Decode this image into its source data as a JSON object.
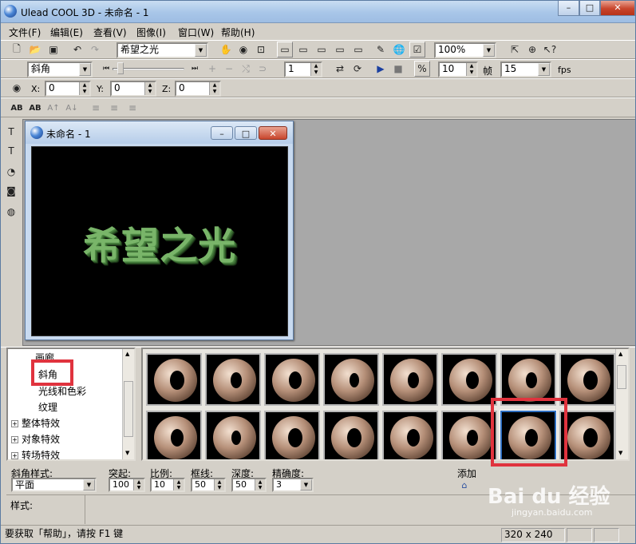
{
  "window": {
    "title": "Ulead COOL 3D - 未命名 - 1",
    "minimize": "–",
    "maximize": "□",
    "close": "✕"
  },
  "menubar": [
    "文件(F)",
    "编辑(E)",
    "查看(V)",
    "图像(I)",
    "窗口(W)",
    "帮助(H)"
  ],
  "toolbar1": {
    "text_combo": "希望之光",
    "zoom_combo": "100%"
  },
  "toolbar2": {
    "bevel_combo": "斜角",
    "frame_value": "1",
    "fps_count": "10",
    "frame_label": "帧",
    "fps_value": "15",
    "fps_label": "fps"
  },
  "toolbar3": {
    "x_label": "X:",
    "x_value": "0",
    "y_label": "Y:",
    "y_value": "0",
    "z_label": "Z:",
    "z_value": "0"
  },
  "toolbar4": {
    "icons": [
      "AB",
      "AB",
      "A↑",
      "A↓"
    ]
  },
  "document": {
    "title": "未命名 - 1",
    "text": "希望之光",
    "text_color": "#79b569"
  },
  "tree": {
    "items": [
      "画廊",
      "斜角",
      "光线和色彩",
      "纹理",
      "整体特效",
      "对象特效",
      "转场特效"
    ],
    "expand": "+"
  },
  "properties": {
    "bevel_style_label": "斜角样式:",
    "bevel_style_value": "平面",
    "protrude_label": "突起:",
    "protrude_value": "100",
    "scale_label": "比例:",
    "scale_value": "10",
    "border_label": "框线:",
    "border_value": "50",
    "depth_label": "深度:",
    "depth_value": "50",
    "precision_label": "精确度:",
    "precision_value": "3",
    "add_label": "添加",
    "style_label": "样式:"
  },
  "statusbar": {
    "help_text": "要获取「帮助」，请按 F1 键",
    "size_text": "320 x 240"
  },
  "watermark": {
    "brand": "Bai du 经验",
    "url": "jingyan.baidu.com"
  },
  "highlight_color": "#e0333e",
  "accent_color": "#2f6fc0"
}
